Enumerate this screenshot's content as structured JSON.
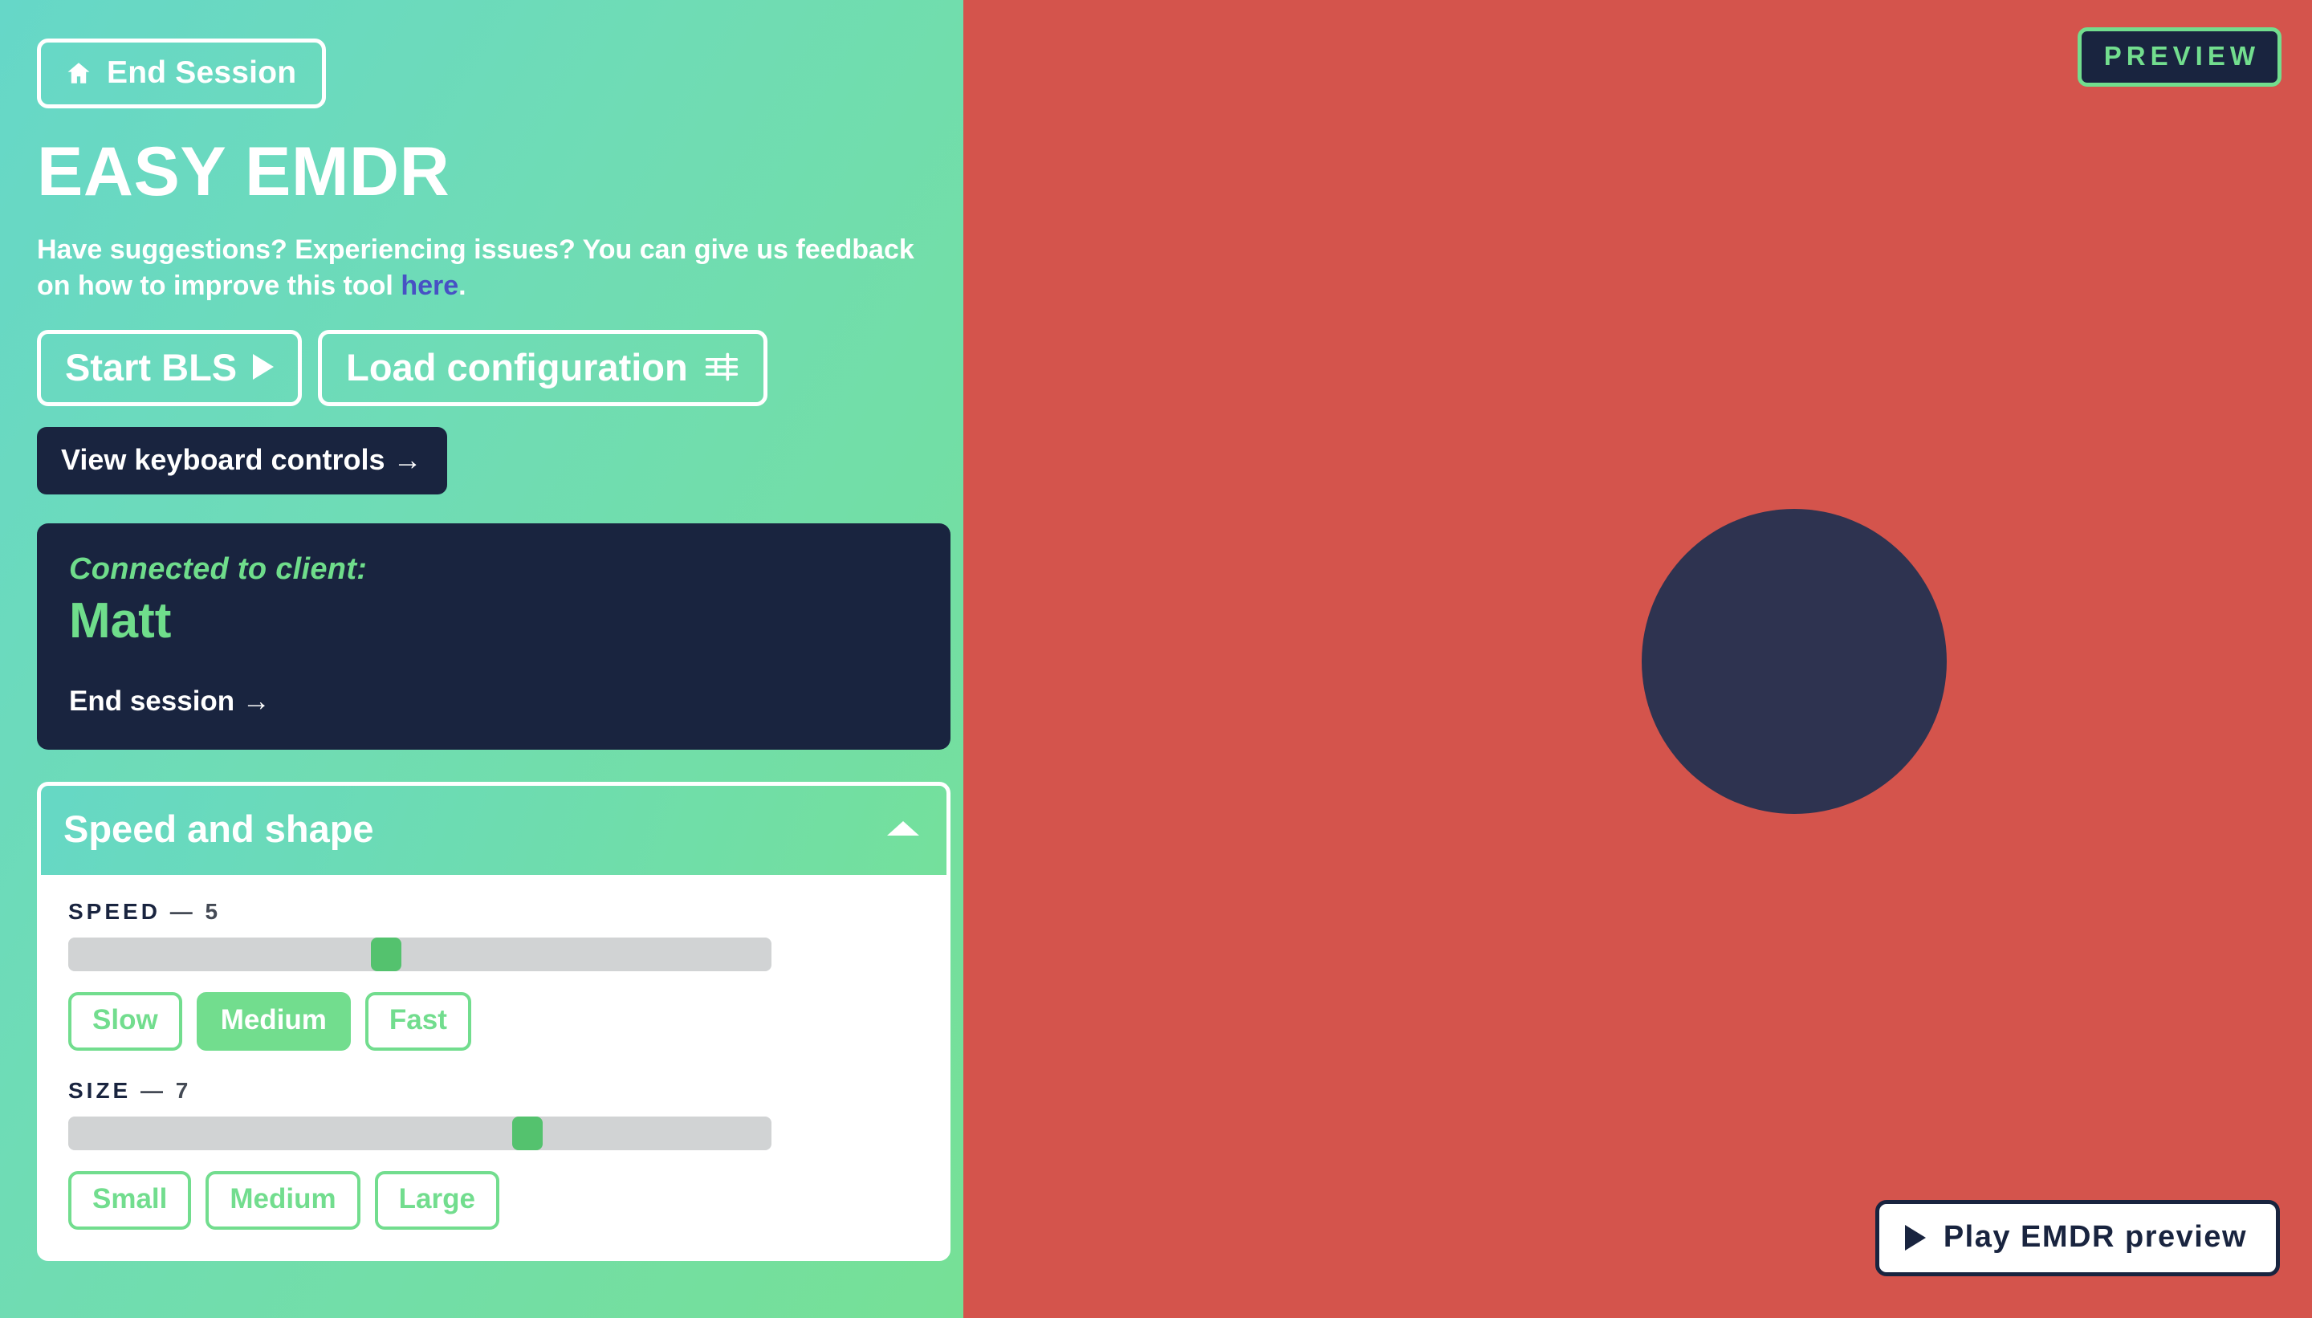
{
  "left": {
    "end_session_top": {
      "label": "End Session",
      "icon": "home-icon"
    },
    "app_title": "EASY EMDR",
    "intro": {
      "before": "Have suggestions? Experiencing issues? You can give us feedback on how to improve this tool ",
      "link": "here",
      "after": "."
    },
    "start_bls": {
      "label": "Start BLS",
      "icon": "play-triangle-icon"
    },
    "load_config": {
      "label": "Load configuration",
      "icon": "sliders-icon"
    },
    "keyboard_controls": "View keyboard controls →",
    "client_card": {
      "connected_label": "Connected to client:",
      "client_name": "Matt",
      "end_session_link": "End session →"
    },
    "accordion": {
      "title": "Speed and shape",
      "caret": "chevron-up-icon",
      "speed": {
        "label": "SPEED",
        "dash": "—",
        "value": "5",
        "slider_percent": 45,
        "chips": [
          {
            "label": "Slow",
            "active": false
          },
          {
            "label": "Medium",
            "active": true
          },
          {
            "label": "Fast",
            "active": false
          }
        ]
      },
      "size": {
        "label": "SIZE",
        "dash": "—",
        "value": "7",
        "slider_percent": 66,
        "chips": [
          {
            "label": "Small",
            "active": false
          },
          {
            "label": "Medium",
            "active": false
          },
          {
            "label": "Large",
            "active": false
          }
        ]
      }
    }
  },
  "right": {
    "preview_badge": "PREVIEW",
    "play_preview": "Play EMDR preview",
    "dot": {
      "shape": "circle"
    }
  },
  "colors": {
    "panel_gradient_start": "#66d7c8",
    "panel_gradient_end": "#76e096",
    "dark_navy": "#19243f",
    "accent_green": "#72dd8e",
    "link_purple": "#4751c4",
    "preview_red": "#d4544c",
    "dot_navy": "#2e3350",
    "slider_track": "#d1d3d4",
    "slider_thumb": "#54c26e"
  }
}
